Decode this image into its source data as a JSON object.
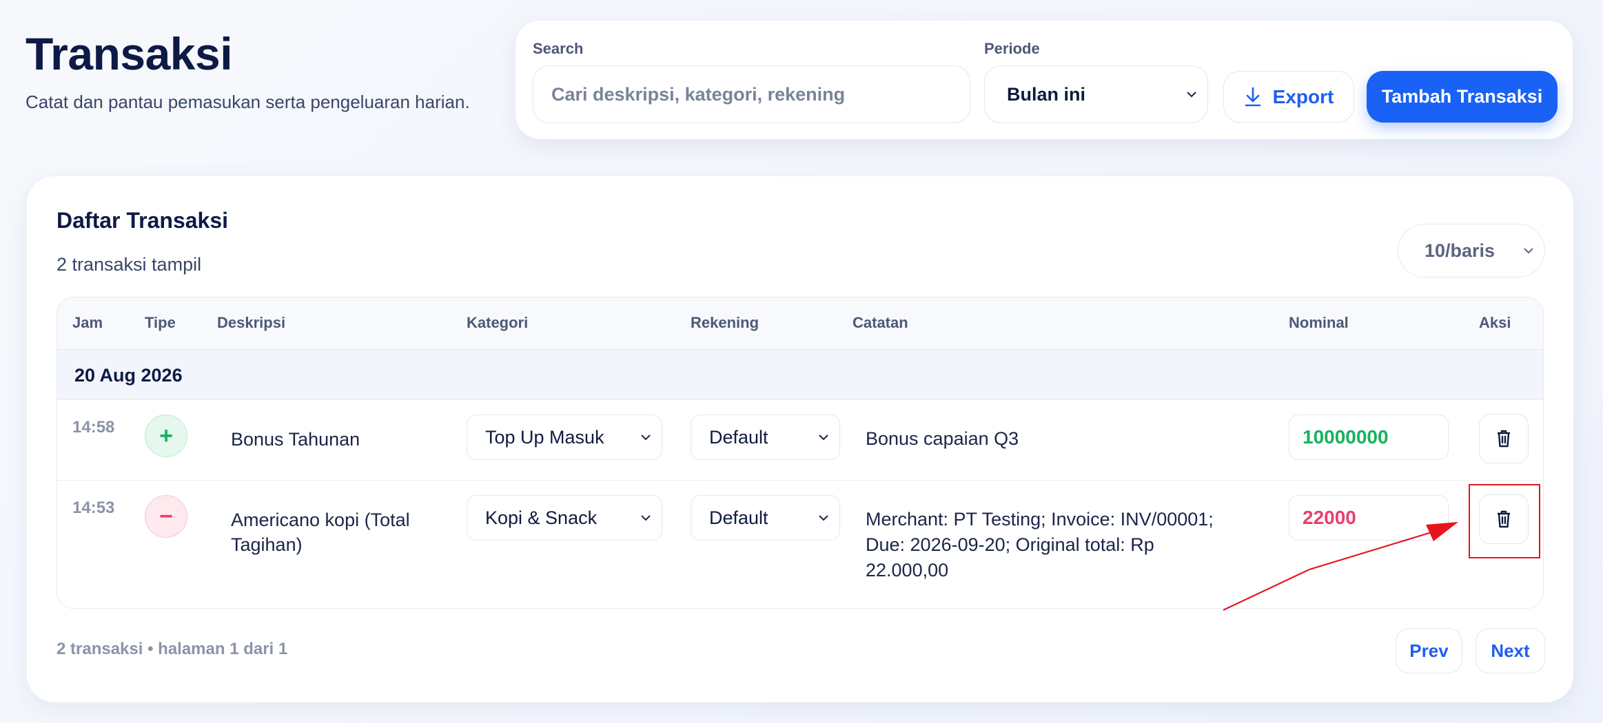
{
  "header": {
    "title": "Transaksi",
    "subtitle": "Catat dan pantau pemasukan serta pengeluaran harian."
  },
  "toolbar": {
    "search_label": "Search",
    "search_placeholder": "Cari deskripsi, kategori, rekening",
    "search_value": "",
    "period_label": "Periode",
    "period_value": "Bulan ini",
    "export_label": "Export",
    "add_label": "Tambah Transaksi"
  },
  "list": {
    "title": "Daftar Transaksi",
    "count_text": "2 transaksi tampil",
    "rows_per_page": "10/baris",
    "columns": [
      "Jam",
      "Tipe",
      "Deskripsi",
      "Kategori",
      "Rekening",
      "Catatan",
      "Nominal",
      "Aksi"
    ],
    "groups": [
      {
        "date": "20 Aug 2026",
        "transactions": [
          {
            "time": "14:58",
            "type": "+",
            "type_kind": "income",
            "description": "Bonus Tahunan",
            "category": "Top Up Masuk",
            "account": "Default",
            "note": "Bonus capaian Q3",
            "amount": "10000000"
          },
          {
            "time": "14:53",
            "type": "−",
            "type_kind": "expense",
            "description": "Americano kopi (Total Tagihan)",
            "category": "Kopi & Snack",
            "account": "Default",
            "note": "Merchant: PT Testing; Invoice: INV/00001; Due: 2026-09-20; Original total: Rp 22.000,00",
            "amount": "22000"
          }
        ]
      }
    ],
    "footer_text": "2 transaksi • halaman 1 dari 1",
    "prev_label": "Prev",
    "next_label": "Next"
  },
  "colors": {
    "primary": "#1a61f5",
    "income": "#18b25c",
    "expense": "#ec3e6c",
    "annotation": "#e8141c"
  },
  "icons": {
    "period_chevron": "chevron-down-icon",
    "export": "download-icon",
    "delete": "trash-icon"
  }
}
